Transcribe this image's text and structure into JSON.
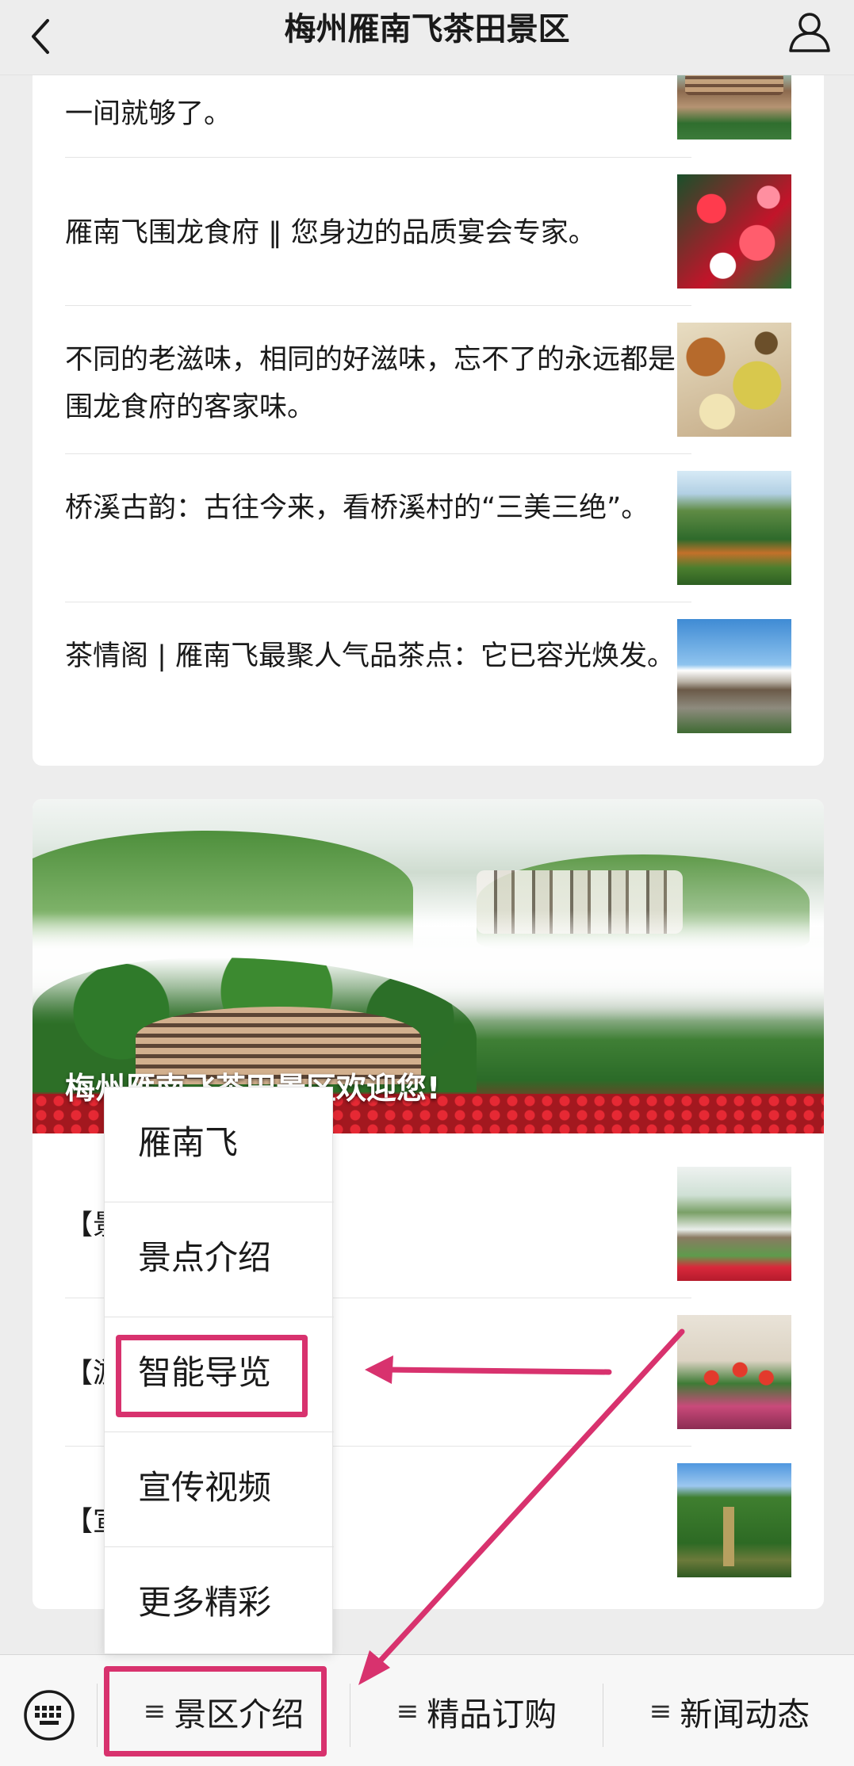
{
  "navbar": {
    "title": "梅州雁南飞茶田景区"
  },
  "top_articles": [
    {
      "title": "一间就够了。"
    },
    {
      "title": "雁南飞围龙食府 ‖ 您身边的品质宴会专家。"
    },
    {
      "title": "不同的老滋味，相同的好滋味，忘不了的永远都是围龙食府的客家味。"
    },
    {
      "title": "桥溪古韵：古往今来，看桥溪村的“三美三绝”。"
    },
    {
      "title": "茶情阁 | 雁南飞最聚人气品茶点：它已容光焕发。"
    }
  ],
  "banner": {
    "caption": "梅州雁南飞茶田景区欢迎您!"
  },
  "bottom_articles": [
    {
      "title": "【景"
    },
    {
      "title": "【游"
    },
    {
      "title": "【宣"
    }
  ],
  "submenu": {
    "items": [
      {
        "label": "雁南飞"
      },
      {
        "label": "景点介绍"
      },
      {
        "label": "智能导览"
      },
      {
        "label": "宣传视频"
      },
      {
        "label": "更多精彩"
      }
    ]
  },
  "bottom_menu": {
    "items": [
      {
        "label": "景区介绍",
        "icon": "≡"
      },
      {
        "label": "精品订购",
        "icon": "≡"
      },
      {
        "label": "新闻动态",
        "icon": "≡"
      }
    ]
  },
  "colors": {
    "highlight": "#d8326e",
    "background": "#ededed"
  }
}
